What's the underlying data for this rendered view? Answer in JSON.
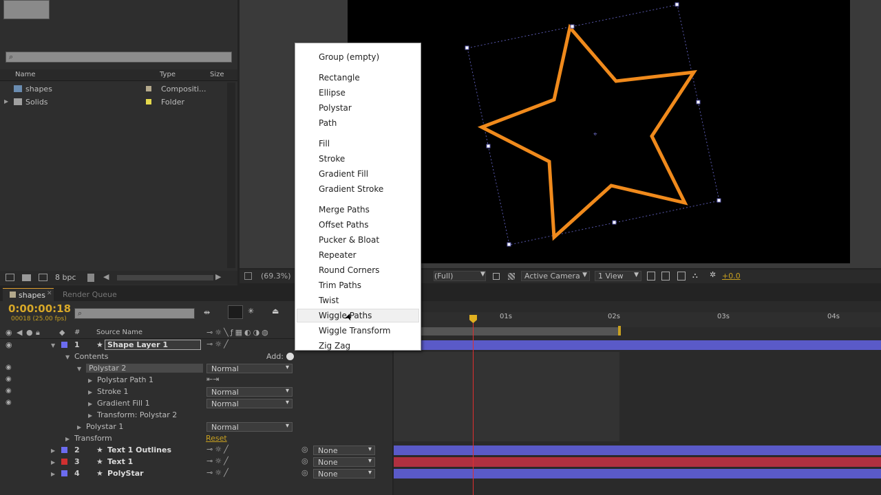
{
  "project": {
    "search_placeholder": "",
    "columns": {
      "name": "Name",
      "type": "Type",
      "size": "Size"
    },
    "items": [
      {
        "name": "shapes",
        "type": "Compositi...",
        "label_color": "#b4a98c"
      },
      {
        "name": "Solids",
        "type": "Folder",
        "label_color": "#e4d84c"
      }
    ],
    "bpc": "8 bpc"
  },
  "viewer": {
    "zoom": "(69.3%)",
    "resolution": "(Full)",
    "camera": "Active Camera",
    "views": "1 View",
    "exposure": "+0.0",
    "star_color": "#f08a1c"
  },
  "menu": {
    "items": [
      "Group (empty)",
      "Rectangle",
      "Ellipse",
      "Polystar",
      "Path",
      "Fill",
      "Stroke",
      "Gradient Fill",
      "Gradient Stroke",
      "Merge Paths",
      "Offset Paths",
      "Pucker & Bloat",
      "Repeater",
      "Round Corners",
      "Trim Paths",
      "Twist",
      "Wiggle Paths",
      "Wiggle Transform",
      "Zig Zag"
    ],
    "highlighted": "Wiggle Paths"
  },
  "timeline": {
    "tabs": [
      "shapes",
      "Render Queue"
    ],
    "timecode": "0:00:00:18",
    "frame_info": "00018 (25.00 fps)",
    "header": {
      "num": "#",
      "source": "Source Name"
    },
    "add_label": "Add:",
    "ruler": [
      "01s",
      "02s",
      "03s",
      "04s"
    ],
    "rows": [
      {
        "num": "1",
        "name": "Shape Layer 1",
        "color": "#6c6cf0"
      },
      {
        "name": "Contents"
      },
      {
        "name": "Polystar 2",
        "mode": "Normal"
      },
      {
        "name": "Polystar Path 1"
      },
      {
        "name": "Stroke 1",
        "mode": "Normal"
      },
      {
        "name": "Gradient Fill 1",
        "mode": "Normal"
      },
      {
        "name": "Transform: Polystar 2"
      },
      {
        "name": "Polystar 1",
        "mode": "Normal"
      },
      {
        "name": "Transform",
        "reset": "Reset"
      },
      {
        "num": "2",
        "name": "Text 1 Outlines",
        "color": "#6c6cf0",
        "parent": "None"
      },
      {
        "num": "3",
        "name": "Text 1",
        "color": "#d03030",
        "parent": "None"
      },
      {
        "num": "4",
        "name": "PolyStar",
        "color": "#6c6cf0",
        "parent": "None"
      }
    ]
  }
}
